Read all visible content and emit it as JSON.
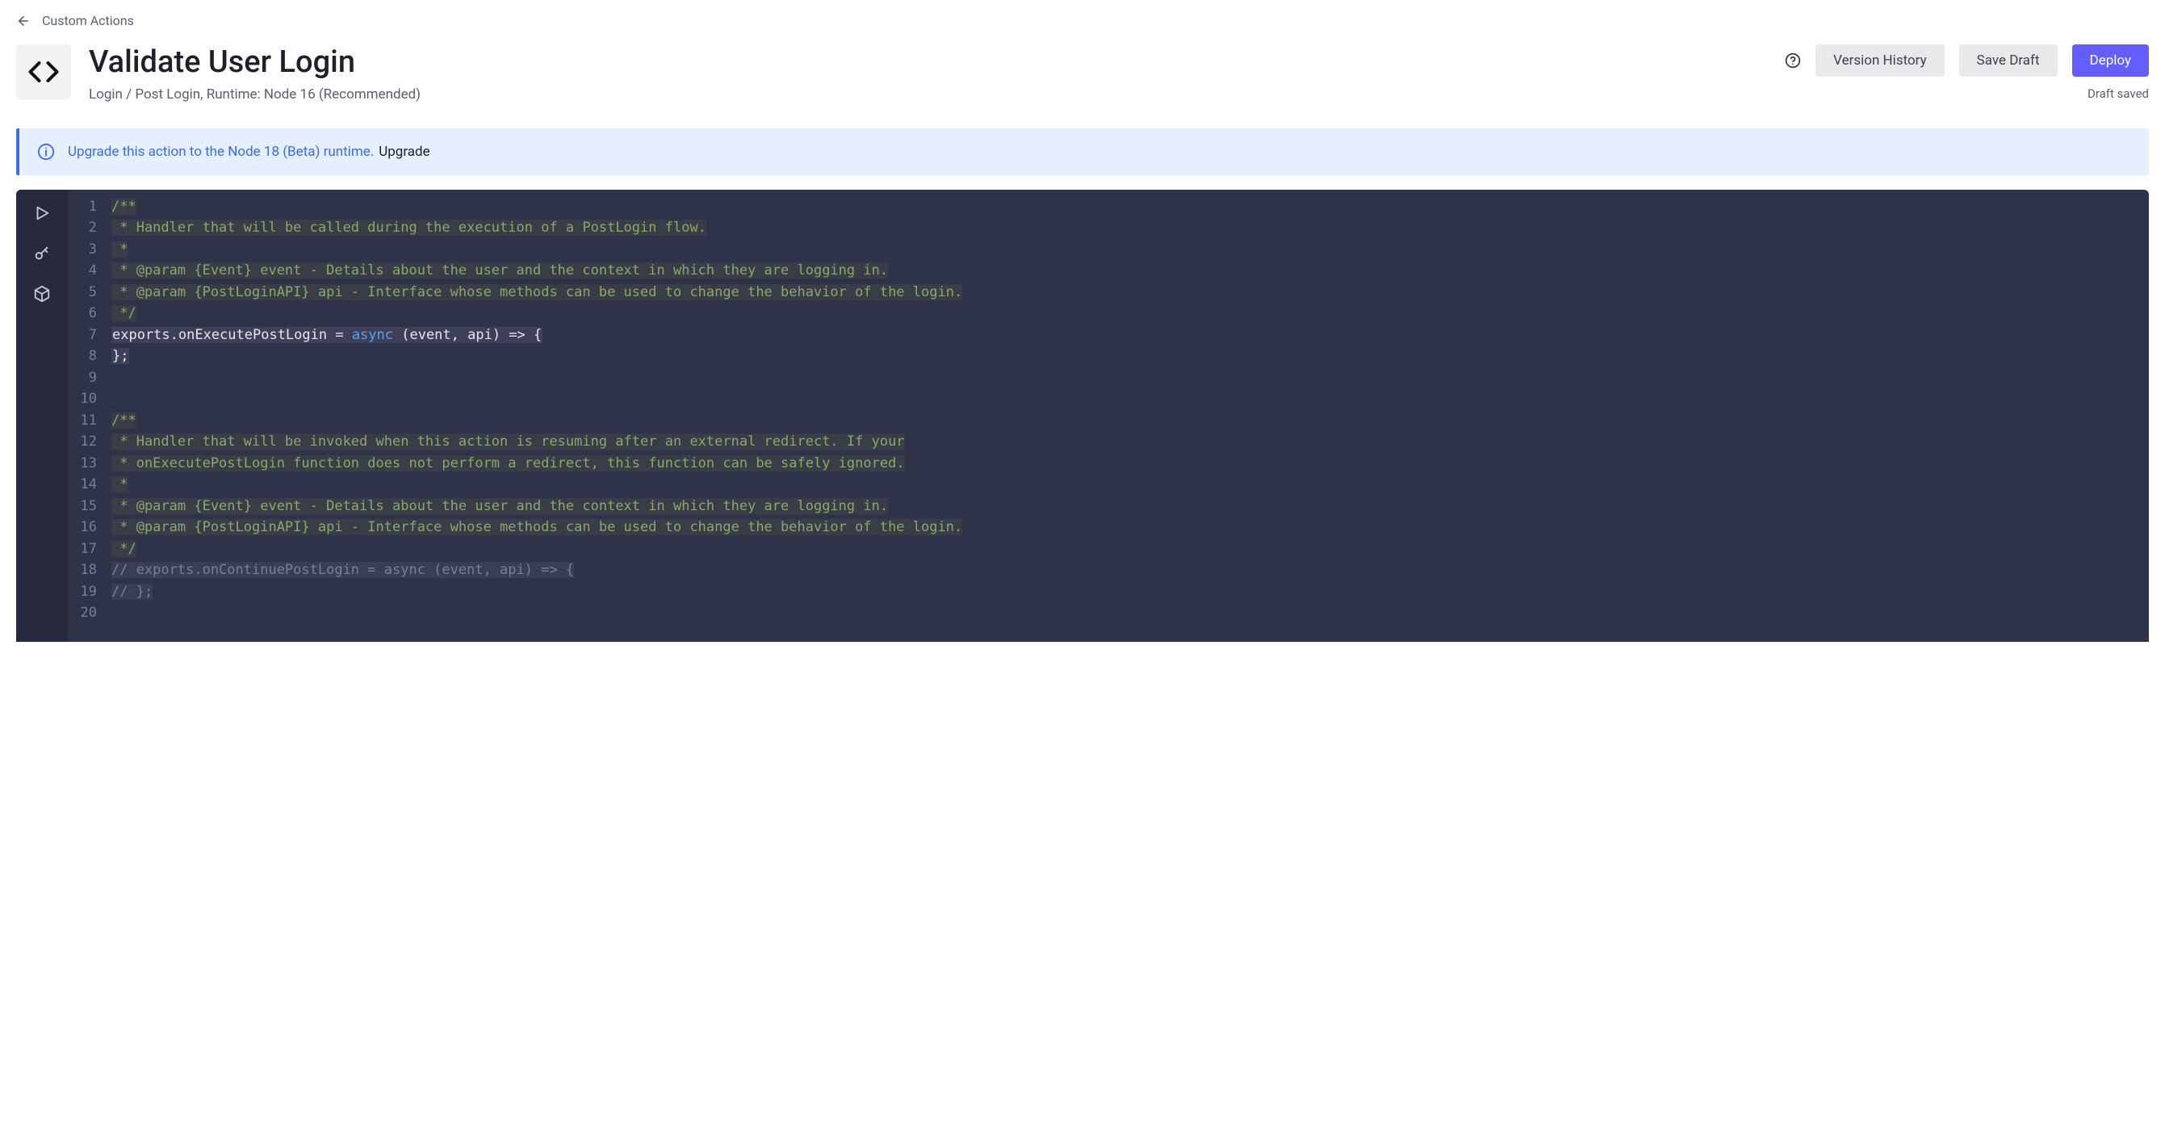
{
  "breadcrumb": {
    "label": "Custom Actions"
  },
  "header": {
    "title": "Validate User Login",
    "subtitle": "Login / Post Login, Runtime: Node 16 (Recommended)"
  },
  "actions": {
    "version_history": "Version History",
    "save_draft": "Save Draft",
    "deploy": "Deploy",
    "status": "Draft saved"
  },
  "banner": {
    "message": "Upgrade this action to the Node 18 (Beta) runtime.",
    "link": "Upgrade"
  },
  "code": {
    "lines": [
      {
        "n": 1,
        "type": "comment",
        "text": "/**"
      },
      {
        "n": 2,
        "type": "comment",
        "text": " * Handler that will be called during the execution of a PostLogin flow."
      },
      {
        "n": 3,
        "type": "comment",
        "text": " *"
      },
      {
        "n": 4,
        "type": "comment",
        "text": " * @param {Event} event - Details about the user and the context in which they are logging in."
      },
      {
        "n": 5,
        "type": "comment",
        "text": " * @param {PostLoginAPI} api - Interface whose methods can be used to change the behavior of the login."
      },
      {
        "n": 6,
        "type": "comment",
        "text": " */"
      },
      {
        "n": 7,
        "type": "code",
        "pre": "exports.onExecutePostLogin = ",
        "kw": "async",
        "post": " (event, api) => {"
      },
      {
        "n": 8,
        "type": "plain",
        "text": "};"
      },
      {
        "n": 9,
        "type": "plain",
        "text": ""
      },
      {
        "n": 10,
        "type": "plain",
        "text": ""
      },
      {
        "n": 11,
        "type": "comment",
        "text": "/**"
      },
      {
        "n": 12,
        "type": "comment",
        "text": " * Handler that will be invoked when this action is resuming after an external redirect. If your"
      },
      {
        "n": 13,
        "type": "comment",
        "text": " * onExecutePostLogin function does not perform a redirect, this function can be safely ignored."
      },
      {
        "n": 14,
        "type": "comment",
        "text": " *"
      },
      {
        "n": 15,
        "type": "comment",
        "text": " * @param {Event} event - Details about the user and the context in which they are logging in."
      },
      {
        "n": 16,
        "type": "comment",
        "text": " * @param {PostLoginAPI} api - Interface whose methods can be used to change the behavior of the login."
      },
      {
        "n": 17,
        "type": "comment",
        "text": " */"
      },
      {
        "n": 18,
        "type": "cline",
        "text": "// exports.onContinuePostLogin = async (event, api) => {"
      },
      {
        "n": 19,
        "type": "cline",
        "text": "// };"
      },
      {
        "n": 20,
        "type": "plain",
        "text": ""
      }
    ]
  }
}
